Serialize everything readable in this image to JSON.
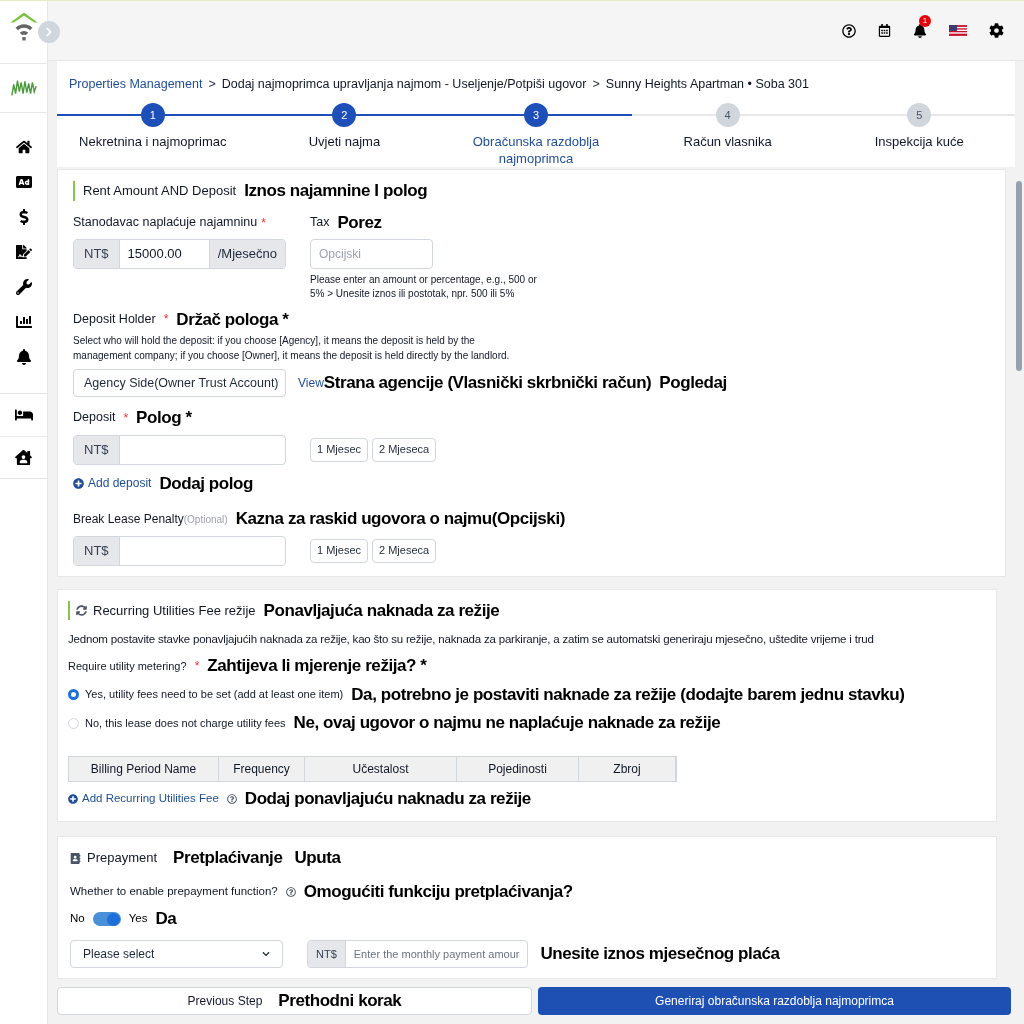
{
  "header": {
    "notification_count": "1"
  },
  "breadcrumb": {
    "separator": ">",
    "items": [
      {
        "label": "Properties Management",
        "kind": "link"
      },
      {
        "label": "Dodaj najmoprimca upravljanja najmom - Useljenje/Potpiši ugovor",
        "kind": "text"
      },
      {
        "label": "Sunny Heights Apartman • Soba 301",
        "kind": "text"
      }
    ]
  },
  "steps": [
    {
      "number": "1",
      "label": "Nekretnina i najmoprimac",
      "reached": true,
      "selected": false
    },
    {
      "number": "2",
      "label": "Uvjeti najma",
      "reached": true,
      "selected": false
    },
    {
      "number": "3",
      "label": "Obračunska razdoblja najmoprimca",
      "reached": true,
      "selected": true
    },
    {
      "number": "4",
      "label": "Račun vlasnika",
      "reached": false,
      "selected": false
    },
    {
      "number": "5",
      "label": "Inspekcija kuće",
      "reached": false,
      "selected": false
    }
  ],
  "rent_section": {
    "title": "Rent Amount AND Deposit",
    "translation": "Iznos najamnine I polog",
    "rent": {
      "label": "Stanodavac naplaćuje najamninu",
      "required_mark": "*",
      "prefix": "NT$",
      "value": "15000.00",
      "suffix": "/Mjesečno"
    },
    "tax": {
      "label": "Tax",
      "translation": "Porez",
      "placeholder": "Opcijski",
      "hint": "Please enter an amount or percentage, e.g., 500 or 5% > Unesite iznos ili postotak, npr. 500 ili 5%"
    },
    "deposit_holder": {
      "label": "Deposit Holder",
      "required_mark": "*",
      "translation": "Držač pologa *",
      "description": "Select who will hold the deposit: if you choose [Agency], it means the deposit is held by the management company; if you choose [Owner], it means the deposit is held directly by the landlord.",
      "value": "Agency Side(Owner Trust Account)",
      "link": "View",
      "value_translation": "Strana agencije (Vlasnički skrbnički račun)",
      "link_translation": "Pogledaj"
    },
    "deposit": {
      "label": "Deposit",
      "required_mark": "*",
      "translation": "Polog *",
      "prefix": "NT$",
      "quick_buttons": [
        "1 Mjesec",
        "2 Mjeseca"
      ]
    },
    "add_deposit": {
      "label": "Add deposit",
      "translation": "Dodaj polog"
    },
    "penalty": {
      "label": "Break Lease Penalty",
      "optional_label": "(Optional)",
      "translation": "Kazna za raskid ugovora o najmu(Opcijski)",
      "prefix": "NT$",
      "quick_buttons": [
        "1 Mjesec",
        "2 Mjeseca"
      ]
    }
  },
  "utilities": {
    "title": "Recurring Utilities Fee režije",
    "translation": "Ponavljajuća naknada za režije",
    "description": "Jednom postavite stavke ponavljajućih naknada za režije, kao što su režije, naknada za parkiranje, a zatim se automatski generiraju mjesečno, uštedite vrijeme i trud",
    "question": {
      "label": "Require utility metering?",
      "required_mark": "*",
      "translation": "Zahtijeva li mjerenje režija? *"
    },
    "options": [
      {
        "label": "Yes, utility fees need to be set (add at least one item)",
        "translation": "Da, potrebno je postaviti naknade za režije (dodajte barem jednu stavku)",
        "selected": true
      },
      {
        "label": "No, this lease does not charge utility fees",
        "translation": "Ne, ovaj ugovor o najmu ne naplaćuje naknade za režije",
        "selected": false
      }
    ],
    "columns": [
      "Billing Period Name",
      "Frequency",
      "Učestalost",
      "Pojedinosti",
      "Zbroj"
    ],
    "add": {
      "label": "Add Recurring Utilities Fee",
      "translation": "Dodaj ponavljajuću naknadu za režije"
    }
  },
  "prepayment": {
    "title": "Prepayment",
    "translation": "Pretplaćivanje",
    "translation_2": "Uputa",
    "question": "Whether to enable prepayment function?",
    "question_translation": "Omogućiti funkciju pretplaćivanja?",
    "toggle": {
      "off_label": "No",
      "on_label": "Yes",
      "on": true,
      "translation": "Da"
    },
    "select_placeholder": "Please select",
    "prefix": "NT$",
    "amount_placeholder": "Enter the monthly payment amour",
    "amount_translation": "Unesite iznos mjesečnog plaća"
  },
  "footer": {
    "previous": "Previous Step",
    "previous_translation": "Prethodni korak",
    "next": "Generiraj obračunska razdoblja najmoprimca"
  }
}
